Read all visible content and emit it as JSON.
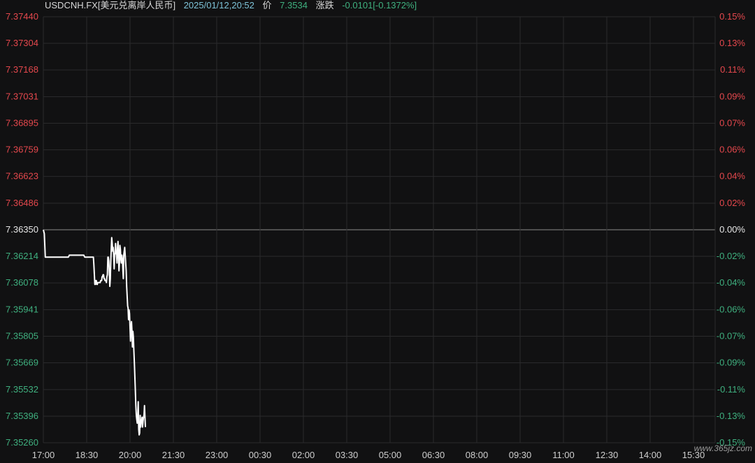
{
  "header": {
    "symbol": "USDCNH.FX[美元兑离岸人民币]",
    "timestamp": "2025/01/12,20:52",
    "price_label": "价",
    "price_value": "7.3534",
    "change_label": "涨跌",
    "change_value": "-0.0101[-0.1372%]"
  },
  "watermark": "www.365jz.com",
  "colors": {
    "background": "#111112",
    "grid": "#2a2a2c",
    "line": "#ffffff",
    "baseline": "#8a8a8a",
    "up": "#e5484d",
    "down": "#3fb07f",
    "neutral": "#e6e6e6"
  },
  "chart_data": {
    "type": "line",
    "base_value": 7.3635,
    "ylim": [
      7.3526,
      7.3744
    ],
    "y_ticks": [
      "7.37440",
      "7.37304",
      "7.37168",
      "7.37031",
      "7.36895",
      "7.36759",
      "7.36623",
      "7.36486",
      "7.36350",
      "7.36214",
      "7.36078",
      "7.35941",
      "7.35805",
      "7.35669",
      "7.35532",
      "7.35396",
      "7.35260"
    ],
    "y_tick_values": [
      7.3744,
      7.37304,
      7.37168,
      7.37031,
      7.36895,
      7.36759,
      7.36623,
      7.36486,
      7.3635,
      7.36214,
      7.36078,
      7.35941,
      7.35805,
      7.35669,
      7.35532,
      7.35396,
      7.3526
    ],
    "pct_ticks": [
      "0.15%",
      "0.13%",
      "0.11%",
      "0.09%",
      "0.07%",
      "0.06%",
      "0.04%",
      "0.02%",
      "0.00%",
      "-0.02%",
      "-0.04%",
      "-0.06%",
      "-0.07%",
      "-0.09%",
      "-0.11%",
      "-0.13%",
      "-0.15%"
    ],
    "x_ticks": [
      "17:00",
      "18:30",
      "20:00",
      "21:30",
      "23:00",
      "00:30",
      "02:00",
      "03:30",
      "05:00",
      "06:30",
      "08:00",
      "09:30",
      "11:00",
      "12:30",
      "14:00",
      "15:30"
    ],
    "x_tick_minutes": [
      0,
      90,
      180,
      270,
      360,
      450,
      540,
      630,
      720,
      810,
      900,
      990,
      1080,
      1170,
      1260,
      1350
    ],
    "x_range_minutes": [
      0,
      1395
    ],
    "series": [
      {
        "x": [
          0,
          2,
          4,
          6,
          10,
          14,
          16,
          18,
          20,
          25,
          30,
          35,
          40,
          45,
          50,
          52,
          54,
          56,
          58,
          60,
          62,
          64,
          66,
          70,
          75,
          78,
          80,
          82,
          84,
          86,
          88,
          90,
          92,
          94,
          96,
          98,
          100,
          102,
          103,
          104,
          105,
          106,
          107,
          108,
          109,
          110,
          111,
          112,
          113,
          114,
          115,
          116,
          117,
          118,
          119,
          120,
          121,
          122,
          123,
          124,
          125,
          126,
          127,
          128,
          129,
          130,
          131,
          132,
          133,
          134,
          135,
          136,
          137,
          138,
          139,
          140,
          141,
          142,
          143,
          144,
          145,
          146,
          147,
          148,
          149,
          150,
          151,
          152,
          153,
          154,
          155,
          156,
          157,
          158,
          159,
          160,
          161,
          162,
          163,
          164,
          165,
          166,
          167,
          168,
          169,
          170,
          171,
          172,
          173,
          174,
          175,
          176,
          177,
          178,
          179,
          180,
          181,
          182,
          183,
          184,
          185,
          186,
          187,
          188,
          189,
          190,
          191,
          192,
          193,
          194,
          195,
          196,
          197,
          198,
          199,
          200,
          201,
          202,
          203,
          204,
          205,
          206,
          207,
          208,
          209,
          210,
          211,
          212
        ],
        "y": [
          7.3635,
          7.3633,
          7.3621,
          7.3621,
          7.3621,
          7.3621,
          7.3621,
          7.3621,
          7.3621,
          7.3621,
          7.3621,
          7.3621,
          7.3621,
          7.3621,
          7.3621,
          7.3621,
          7.3622,
          7.3622,
          7.3622,
          7.3622,
          7.3622,
          7.3622,
          7.3622,
          7.3622,
          7.3622,
          7.3622,
          7.3622,
          7.3622,
          7.3622,
          7.3621,
          7.3621,
          7.3621,
          7.3621,
          7.3621,
          7.3621,
          7.3621,
          7.3621,
          7.3621,
          7.3621,
          7.3621,
          7.3617,
          7.3612,
          7.3607,
          7.3607,
          7.3609,
          7.3609,
          7.3607,
          7.3607,
          7.3608,
          7.3608,
          7.3608,
          7.3608,
          7.3608,
          7.3608,
          7.3609,
          7.3609,
          7.3609,
          7.3611,
          7.3611,
          7.3612,
          7.3612,
          7.361,
          7.361,
          7.3609,
          7.3609,
          7.3609,
          7.3608,
          7.3611,
          7.3612,
          7.3621,
          7.3621,
          7.3619,
          7.3613,
          7.3606,
          7.361,
          7.3618,
          7.3625,
          7.3631,
          7.3628,
          7.3624,
          7.3626,
          7.3622,
          7.3615,
          7.3622,
          7.3623,
          7.3628,
          7.3624,
          7.3622,
          7.3618,
          7.3626,
          7.3629,
          7.3623,
          7.3614,
          7.3618,
          7.3627,
          7.3625,
          7.362,
          7.3618,
          7.3622,
          7.362,
          7.3615,
          7.361,
          7.3622,
          7.3624,
          7.3626,
          7.3622,
          7.3618,
          7.3614,
          7.3606,
          7.3601,
          7.3596,
          7.3595,
          7.3589,
          7.3594,
          7.3592,
          7.3585,
          7.3578,
          7.3584,
          7.3588,
          7.3583,
          7.3575,
          7.3583,
          7.358,
          7.3573,
          7.3567,
          7.356,
          7.3553,
          7.3545,
          7.354,
          7.3538,
          7.3536,
          7.354,
          7.3547,
          7.3533,
          7.353,
          7.3531,
          7.354,
          7.3534,
          7.3537,
          7.3537,
          7.3539,
          7.3534,
          7.3537,
          7.3539,
          7.354,
          7.3545,
          7.3539,
          7.3534
        ]
      }
    ]
  }
}
